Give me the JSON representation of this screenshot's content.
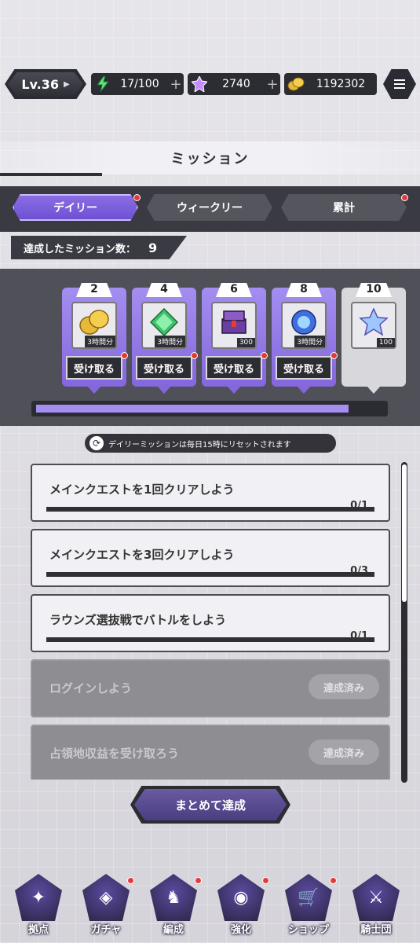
{
  "status_bar": {
    "level": "Lv.36",
    "stamina": "17/100",
    "gems": "2740",
    "gold": "1192302"
  },
  "title": "ミッション",
  "tabs": [
    {
      "label": "デイリー",
      "active": true,
      "has_notice": true
    },
    {
      "label": "ウィークリー",
      "active": false,
      "has_notice": false
    },
    {
      "label": "累計",
      "active": false,
      "has_notice": true
    }
  ],
  "achieved": {
    "label": "達成したミッション数：",
    "count": "9"
  },
  "milestones": [
    {
      "step": "2",
      "qty": "3時間分",
      "item": "gold-coins-icon",
      "button": "受け取る",
      "claimable": true
    },
    {
      "step": "4",
      "qty": "3時間分",
      "item": "green-crystal-icon",
      "button": "受け取る",
      "claimable": true
    },
    {
      "step": "6",
      "qty": "300",
      "item": "chest-icon",
      "button": "受け取る",
      "claimable": true
    },
    {
      "step": "8",
      "qty": "3時間分",
      "item": "blue-orb-icon",
      "button": "受け取る",
      "claimable": true
    },
    {
      "step": "10",
      "qty": "100",
      "item": "star-gem-icon",
      "button": "",
      "claimable": false
    }
  ],
  "progress_fraction": 0.9,
  "reset_note": "デイリーミッションは毎日15時にリセットされます",
  "missions": [
    {
      "title": "メインクエストを1回クリアしよう",
      "progress": "0/1",
      "completed": false
    },
    {
      "title": "メインクエストを3回クリアしよう",
      "progress": "0/3",
      "completed": false
    },
    {
      "title": "ラウンズ選抜戦でバトルをしよう",
      "progress": "0/1",
      "completed": false
    },
    {
      "title": "ログインしよう",
      "status": "達成済み",
      "completed": true
    },
    {
      "title": "占領地収益を受け取ろう",
      "status": "達成済み",
      "completed": true
    }
  ],
  "bulk_button": "まとめて達成",
  "nav": [
    {
      "label": "拠点",
      "icon": "base-icon",
      "has_notice": false
    },
    {
      "label": "ガチャ",
      "icon": "gacha-icon",
      "has_notice": true
    },
    {
      "label": "編成",
      "icon": "formation-icon",
      "has_notice": true
    },
    {
      "label": "強化",
      "icon": "enhance-icon",
      "has_notice": true
    },
    {
      "label": "ショップ",
      "icon": "shop-icon",
      "has_notice": true
    },
    {
      "label": "騎士団",
      "icon": "knights-icon",
      "has_notice": false
    }
  ],
  "colors": {
    "accent": "#8d6fe6",
    "dark": "#2c2c33",
    "notice": "#e53a3a"
  }
}
